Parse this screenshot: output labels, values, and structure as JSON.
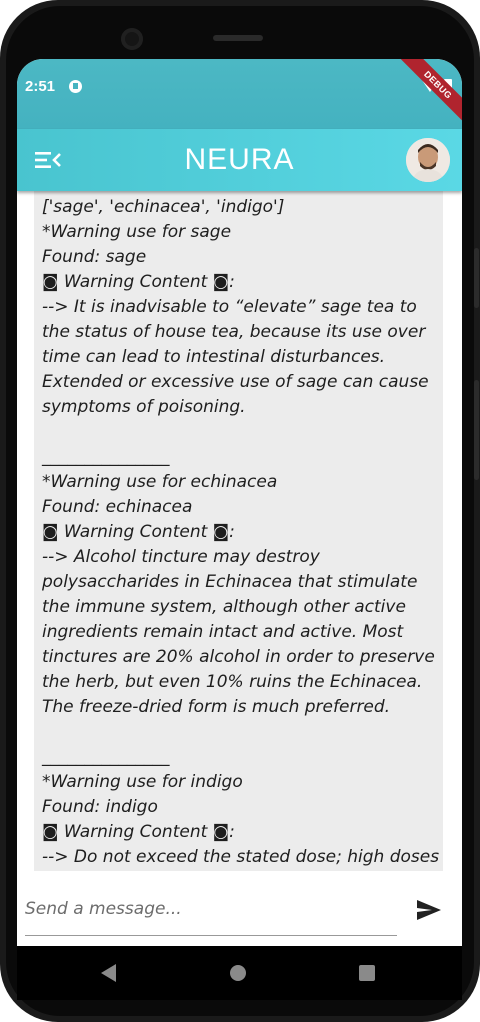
{
  "status_bar": {
    "time": "2:51",
    "debug_label": "DEBUG"
  },
  "app_bar": {
    "title": "NEURA",
    "menu_icon": "menu-collapse-icon",
    "avatar_icon": "user-avatar"
  },
  "chat": {
    "message": "['sage', 'echinacea', 'indigo']\n*Warning use for sage\nFound: sage\n◙ Warning Content ◙:\n--> It is inadvisable to “elevate” sage tea to the status of house tea, because its use over time can lead to intestinal disturbances.  Extended or excessive use of sage can cause symptoms of poisoning.\n\n_______________\n*Warning use for echinacea\nFound: echinacea\n◙ Warning Content ◙:\n--> Alcohol tincture may destroy polysaccharides in Echinacea that stimulate the immune system, although other active ingredients remain intact and active. Most tinctures are 20% alcohol in order to preserve the herb, but even 10% ruins the Echinacea. The freeze-dried form is much preferred.\n\n_______________\n*Warning use for indigo\nFound: indigo\n◙ Warning Content ◙:\n--> Do not exceed the stated dose; high doses may cause vomiting.\n\n_______________"
  },
  "composer": {
    "placeholder": "Send a message...",
    "send_icon": "send-icon"
  },
  "nav": {
    "back_icon": "back-triangle-icon",
    "home_icon": "home-circle-icon",
    "recents_icon": "recents-square-icon"
  },
  "colors": {
    "status_bar": "#46b4c1",
    "app_bar_start": "#49c4cf",
    "app_bar_end": "#5ad8e5",
    "bubble": "#ececec",
    "debug_banner": "#b0242e"
  }
}
